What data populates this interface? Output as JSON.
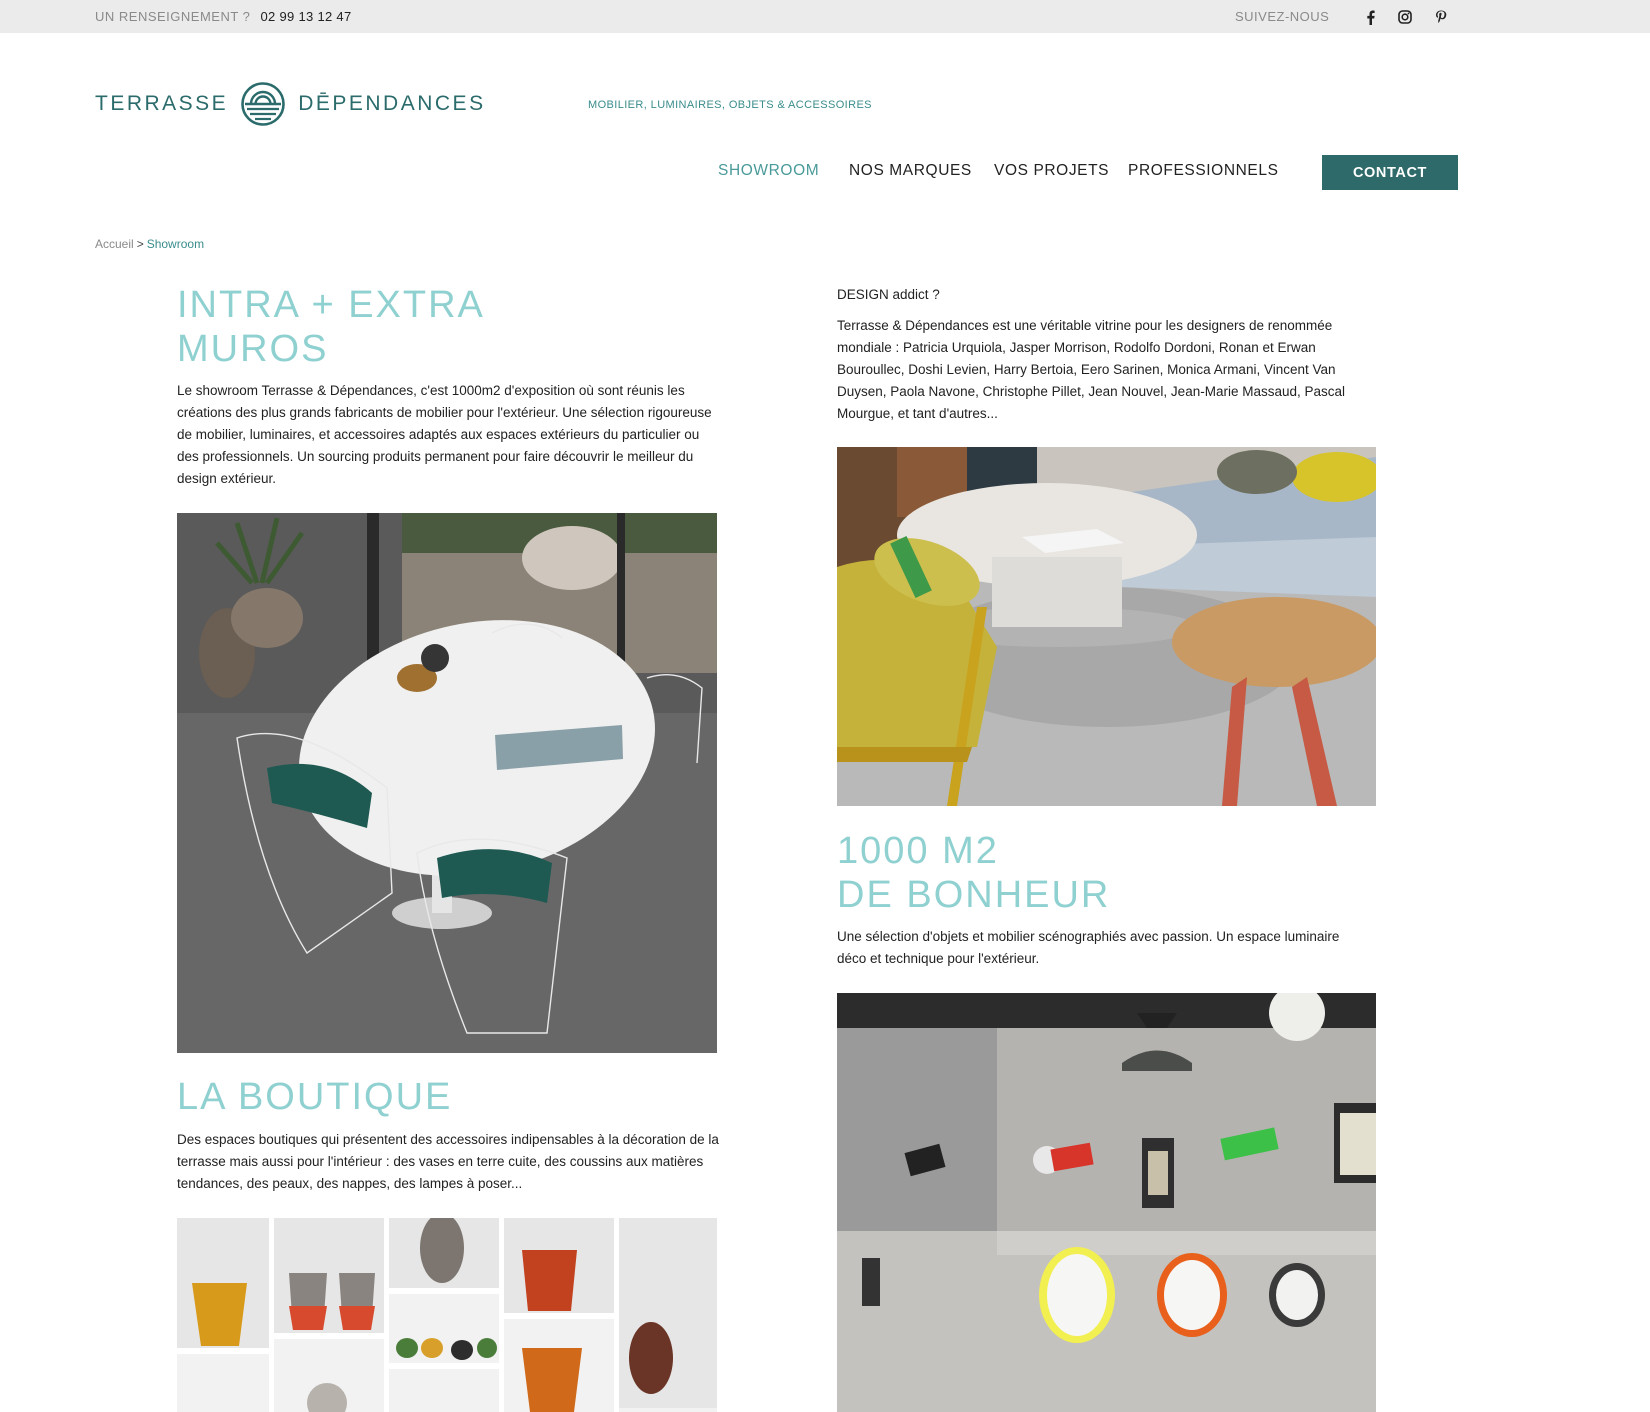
{
  "topbar": {
    "info_label": "UN RENSEIGNEMENT ?",
    "phone": "02 99 13 12 47",
    "follow_label": "SUIVEZ-NOUS",
    "social_icons": [
      "facebook-icon",
      "instagram-icon",
      "pinterest-icon"
    ]
  },
  "header": {
    "logo_left": "TERRASSE",
    "logo_right": "DĒPENDANCES",
    "tagline": "MOBILIER, LUMINAIRES, OBJETS & ACCESSOIRES"
  },
  "nav": {
    "items": [
      {
        "label": "SHOWROOM",
        "active": true
      },
      {
        "label": "NOS MARQUES",
        "active": false
      },
      {
        "label": "VOS PROJETS",
        "active": false
      },
      {
        "label": "PROFESSIONNELS",
        "active": false
      }
    ],
    "contact_label": "CONTACT"
  },
  "breadcrumb": {
    "home": "Accueil",
    "separator": ">",
    "current": "Showroom"
  },
  "sections": {
    "intra": {
      "title_line1": "INTRA + EXTRA",
      "title_line2": "MUROS",
      "text": "Le showroom Terrasse & Dépendances, c'est 1000m2 d'exposition où sont réunis les créations des plus grands fabricants de mobilier pour l'extérieur. Une sélection rigoureuse de mobilier, luminaires, et accessoires adaptés aux espaces extérieurs du particulier ou des professionnels. Un sourcing produits permanent pour faire découvrir le meilleur du design extérieur."
    },
    "design": {
      "subtitle": "DESIGN addict ?",
      "text": "Terrasse & Dépendances est une véritable vitrine pour les designers de renommée mondiale : Patricia Urquiola, Jasper Morrison, Rodolfo Dordoni, Ronan et Erwan Bouroullec, Doshi Levien, Harry Bertoia, Eero Sarinen, Monica Armani, Vincent Van Duysen, Paola Navone, Christophe Pillet, Jean Nouvel, Jean-Marie Massaud, Pascal Mourgue, et tant d'autres..."
    },
    "bonheur": {
      "title_line1": "1000 M2",
      "title_line2": "DE BONHEUR",
      "text": "Une sélection d'objets et mobilier scénographiés avec passion. Un espace luminaire déco et technique pour l'extérieur."
    },
    "boutique": {
      "title": "LA BOUTIQUE",
      "text": "Des espaces boutiques qui présentent des accessoires indipensables à la décoration de la terrasse mais aussi pour l'intérieur : des vases en terre cuite,  des coussins aux matières tendances, des peaux, des nappes, des lampes à poser..."
    }
  },
  "colors": {
    "brand": "#2e6a69",
    "title_accent": "#8fd0d0",
    "topbar_bg": "#ebebeb"
  }
}
